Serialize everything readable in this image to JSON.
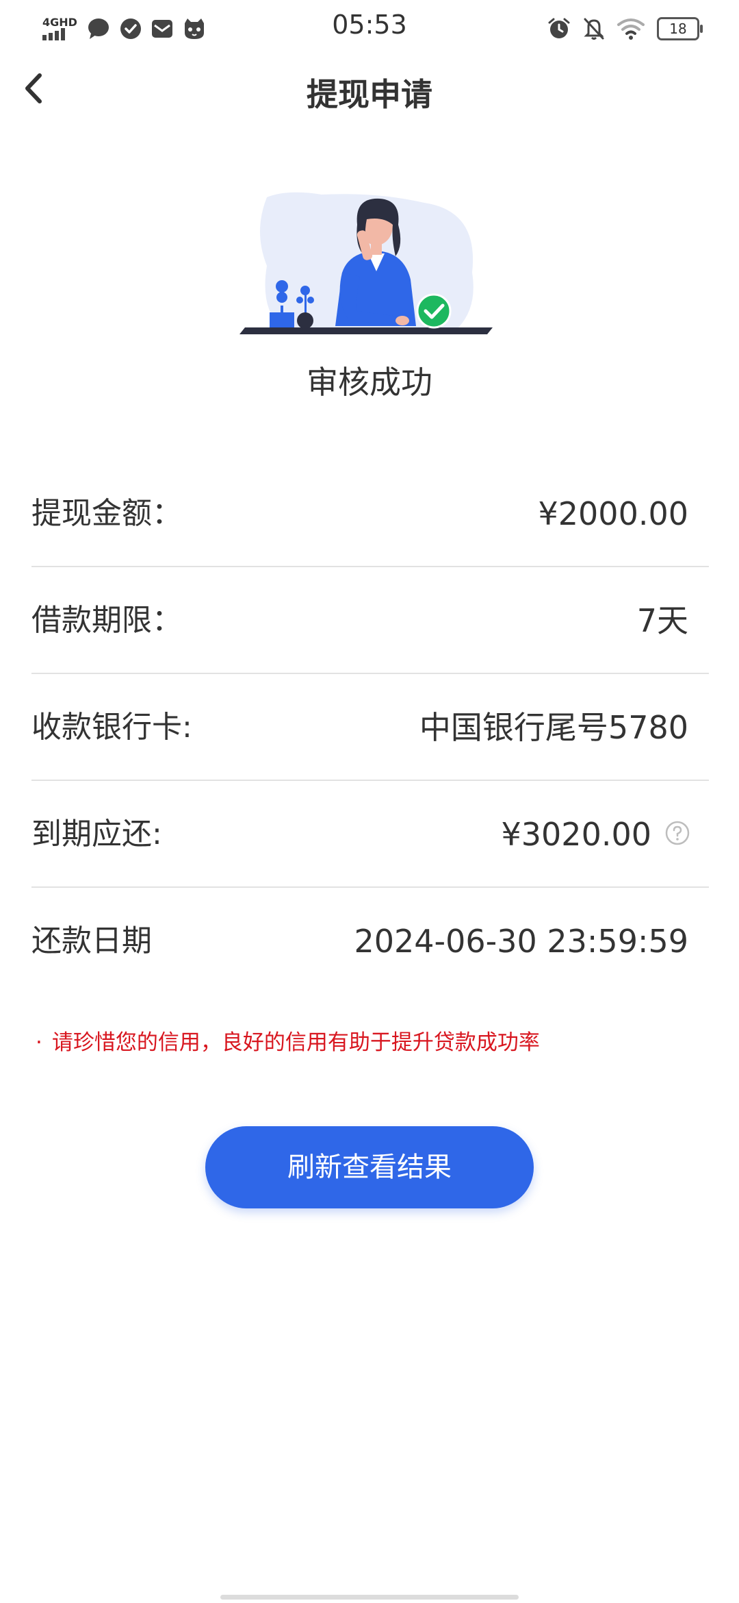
{
  "status_bar": {
    "network": "4GHD",
    "time": "05:53",
    "battery": "18",
    "left_icons": [
      "message-icon",
      "check-circle-icon",
      "mail-icon",
      "cat-face-icon"
    ],
    "right_icons": [
      "alarm-icon",
      "bell-off-icon",
      "wifi-icon"
    ]
  },
  "nav": {
    "back_icon": "chevron-left-icon",
    "title": "提现申请"
  },
  "illustration": {
    "name": "woman-at-desk-illustration",
    "badge": "check-badge-icon",
    "accent_color": "#2f67e8",
    "success_color": "#1db85f"
  },
  "status": {
    "text": "审核成功"
  },
  "info": {
    "rows": [
      {
        "label": "提现金额：",
        "value": "¥2000.00"
      },
      {
        "label": "借款期限：",
        "value": "7天"
      },
      {
        "label": "收款银行卡:",
        "value": "中国银行尾号5780"
      },
      {
        "label": "到期应还:",
        "value": "¥3020.00",
        "icon": "help-circle-icon"
      },
      {
        "label": "还款日期",
        "value": "2024-06-30 23:59:59"
      }
    ]
  },
  "notice": {
    "dot": "·",
    "text": "请珍惜您的信用，良好的信用有助于提升贷款成功率",
    "color": "#d8161f"
  },
  "action": {
    "refresh_label": "刷新查看结果",
    "color": "#2f67e8"
  }
}
